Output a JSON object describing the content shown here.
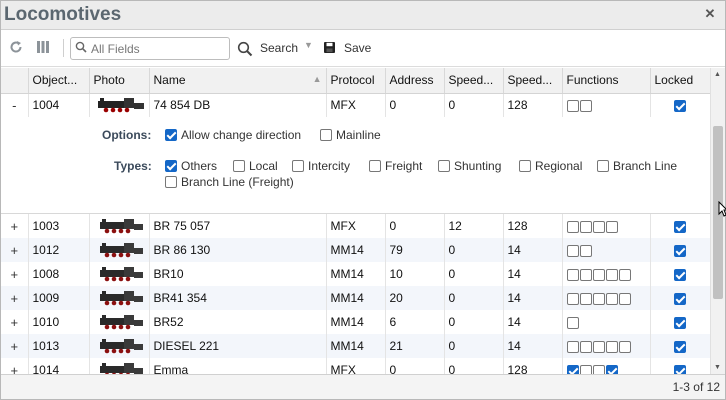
{
  "window": {
    "title": "Locomotives",
    "close_glyph": "✕"
  },
  "toolbar": {
    "refresh_icon": "refresh-icon",
    "columns_icon": "columns-icon",
    "search_placeholder": "All Fields",
    "search_label": "Search",
    "save_label": "Save"
  },
  "columns": [
    "Object...",
    "Photo",
    "Name",
    "Protocol",
    "Address",
    "Speed...",
    "Speed...",
    "Functions",
    "Locked"
  ],
  "expanded": {
    "expander": "-",
    "object_id": "1004",
    "name": "74 854 DB",
    "protocol": "MFX",
    "address": "0",
    "speed1": "0",
    "speed2": "128",
    "functions": [
      false,
      false
    ],
    "locked": true,
    "options_label": "Options:",
    "options": [
      {
        "label": "Allow change direction",
        "checked": true
      },
      {
        "label": "Mainline",
        "checked": false
      }
    ],
    "types_label": "Types:",
    "types": [
      {
        "label": "Others",
        "checked": true
      },
      {
        "label": "Local",
        "checked": false
      },
      {
        "label": "Intercity",
        "checked": false
      },
      {
        "label": "Freight",
        "checked": false
      },
      {
        "label": "Shunting",
        "checked": false
      },
      {
        "label": "Regional",
        "checked": false
      },
      {
        "label": "Branch Line",
        "checked": false
      },
      {
        "label": "Branch Line (Freight)",
        "checked": false
      }
    ]
  },
  "rows": [
    {
      "expander": "+",
      "object_id": "1003",
      "name": "BR 75 057",
      "protocol": "MFX",
      "address": "0",
      "speed1": "12",
      "speed2": "128",
      "functions": [
        false,
        false,
        false,
        false
      ],
      "locked": true
    },
    {
      "expander": "+",
      "object_id": "1012",
      "name": "BR 86 130",
      "protocol": "MM14",
      "address": "79",
      "speed1": "0",
      "speed2": "14",
      "functions": [
        false,
        false
      ],
      "locked": true
    },
    {
      "expander": "+",
      "object_id": "1008",
      "name": "BR10",
      "protocol": "MM14",
      "address": "10",
      "speed1": "0",
      "speed2": "14",
      "functions": [
        false,
        false,
        false,
        false,
        false
      ],
      "locked": true
    },
    {
      "expander": "+",
      "object_id": "1009",
      "name": "BR41 354",
      "protocol": "MM14",
      "address": "20",
      "speed1": "0",
      "speed2": "14",
      "functions": [
        false,
        false,
        false,
        false,
        false
      ],
      "locked": true
    },
    {
      "expander": "+",
      "object_id": "1010",
      "name": "BR52",
      "protocol": "MM14",
      "address": "6",
      "speed1": "0",
      "speed2": "14",
      "functions": [
        false
      ],
      "locked": true
    },
    {
      "expander": "+",
      "object_id": "1013",
      "name": "DIESEL 221",
      "protocol": "MM14",
      "address": "21",
      "speed1": "0",
      "speed2": "14",
      "functions": [
        false,
        false,
        false,
        false,
        false
      ],
      "locked": true
    },
    {
      "expander": "+",
      "object_id": "1014",
      "name": "Emma",
      "protocol": "MFX",
      "address": "0",
      "speed1": "0",
      "speed2": "128",
      "functions": [
        true,
        false,
        false,
        true
      ],
      "locked": true
    }
  ],
  "footer": {
    "count": "1-3 of 12"
  },
  "colors": {
    "accent": "#1467c7",
    "title": "#5b6770",
    "alt_row": "#f3f6fb"
  }
}
